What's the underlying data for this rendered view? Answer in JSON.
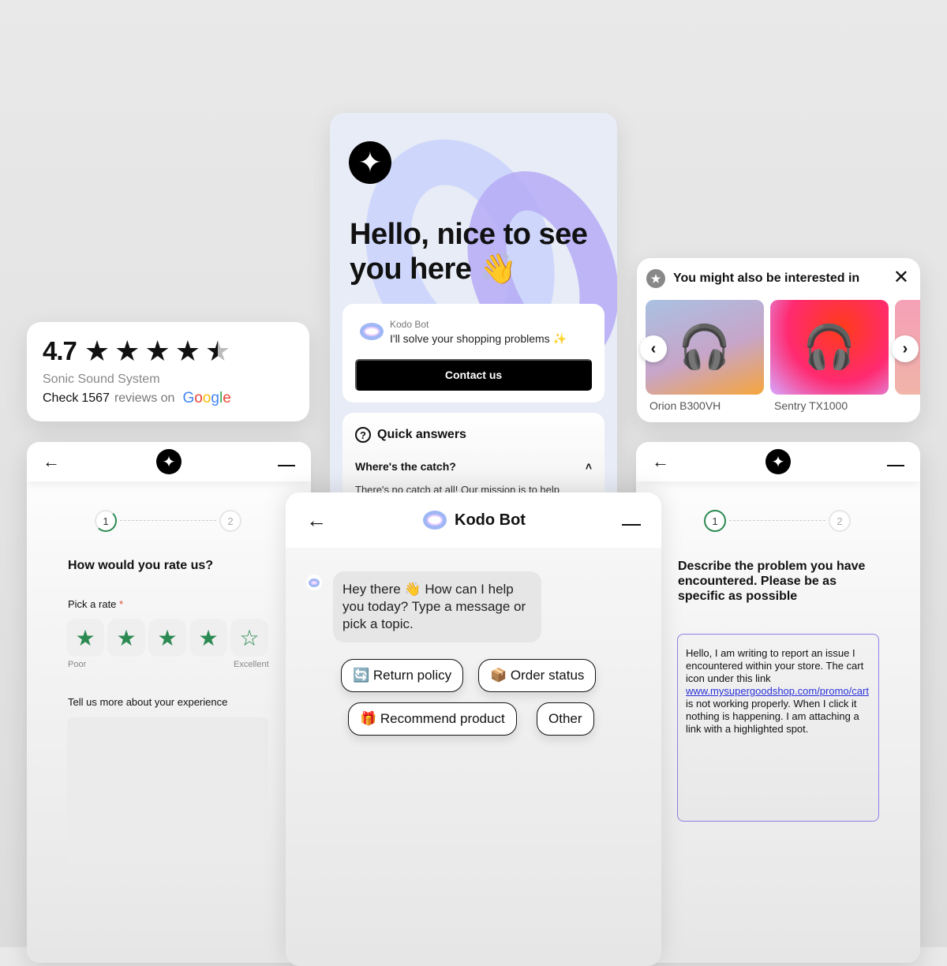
{
  "rating_card": {
    "score": "4.7",
    "stars_filled": 4.5,
    "stars_max": 5,
    "product": "Sonic Sound System",
    "check_prefix": "Check",
    "review_count": "1567",
    "reviews_on": "reviews on",
    "provider": [
      "G",
      "o",
      "o",
      "g",
      "l",
      "e"
    ]
  },
  "hello_panel": {
    "logo_icon": "sparkle-icon",
    "headline": "Hello, nice to see you here 👋",
    "bot_name": "Kodo Bot",
    "bot_tagline": "I'll solve your shopping problems ✨",
    "contact_button": "Contact us",
    "quick_answers": {
      "title": "Quick answers",
      "question": "Where's the catch?",
      "answer_preview": "There's no catch at all! Our mission is to help"
    }
  },
  "products_card": {
    "title": "You might also be interested in",
    "items": [
      {
        "name": "Orion B300VH"
      },
      {
        "name": "Sentry TX1000"
      },
      {
        "name": ""
      }
    ]
  },
  "rating_form": {
    "steps": [
      "1",
      "2"
    ],
    "current_step": 1,
    "question": "How would you rate us?",
    "pick_label": "Pick a rate",
    "required_mark": "*",
    "selected_rating": 4,
    "max_rating": 5,
    "low_label": "Poor",
    "high_label": "Excellent",
    "more_label": "Tell us more about your experience",
    "more_value": ""
  },
  "chat": {
    "title": "Kodo Bot",
    "message": "Hey there 👋 How can I help you today? Type a message or pick a topic.",
    "chips": [
      {
        "label": "🔄 Return policy"
      },
      {
        "label": "📦 Order status"
      },
      {
        "label": "🎁 Recommend product"
      },
      {
        "label": "Other"
      }
    ]
  },
  "problem_form": {
    "steps": [
      "1",
      "2"
    ],
    "current_step": 1,
    "question": "Describe the problem you have encountered. Please be as specific as possible",
    "text_before": "Hello,  I am writing to report an issue I encountered within your store. The cart icon under this link ",
    "link": "www.mysupergoodshop.com/promo/cart",
    "text_after": " is not working properly.  When I click it nothing is happening. I am attaching a link with a highlighted spot."
  }
}
